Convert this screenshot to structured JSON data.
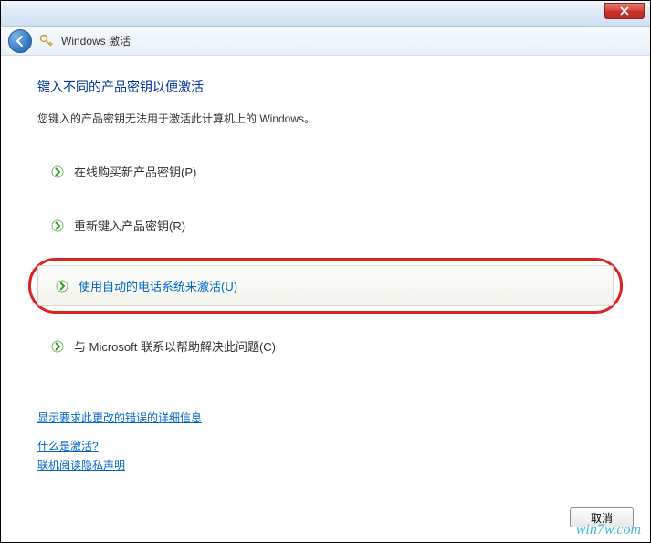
{
  "titlebar": {},
  "nav": {
    "title": "Windows 激活"
  },
  "main": {
    "heading": "键入不同的产品密钥以便激活",
    "subtext": "您键入的产品密钥无法用于激活此计算机上的 Windows。"
  },
  "options": [
    {
      "label": "在线购买新产品密钥(P)"
    },
    {
      "label": "重新键入产品密钥(R)"
    },
    {
      "label": "使用自动的电话系统来激活(U)"
    },
    {
      "label": "与 Microsoft 联系以帮助解决此问题(C)"
    }
  ],
  "links": {
    "details": "显示要求此更改的错误的详细信息",
    "what_is": "什么是激活?",
    "privacy": "联机阅读隐私声明"
  },
  "footer": {
    "cancel": "取消"
  },
  "watermark": "win7w.com"
}
